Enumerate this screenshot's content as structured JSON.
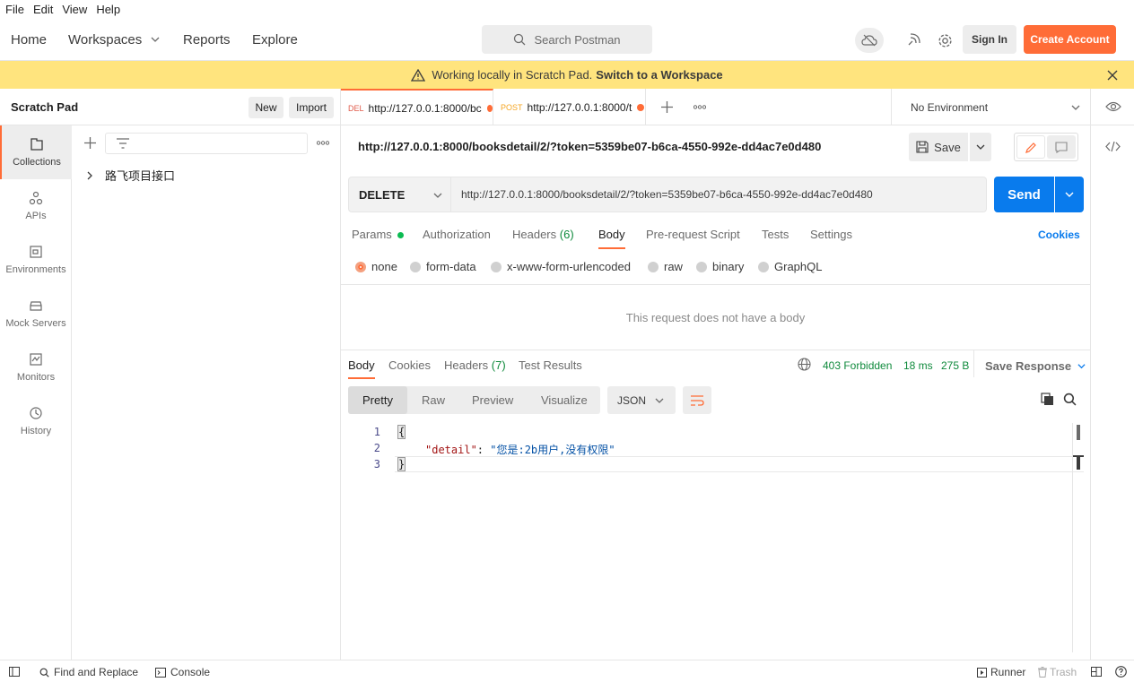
{
  "menu": [
    "File",
    "Edit",
    "View",
    "Help"
  ],
  "nav": {
    "home": "Home",
    "workspaces": "Workspaces",
    "reports": "Reports",
    "explore": "Explore"
  },
  "search": {
    "placeholder": "Search Postman"
  },
  "header": {
    "signin": "Sign In",
    "create_account": "Create Account"
  },
  "banner": {
    "text": "Working locally in Scratch Pad.",
    "link": "Switch to a Workspace"
  },
  "sidebar": {
    "title": "Scratch Pad",
    "new_label": "New",
    "import_label": "Import",
    "items": [
      {
        "label": "Collections"
      },
      {
        "label": "APIs"
      },
      {
        "label": "Environments"
      },
      {
        "label": "Mock Servers"
      },
      {
        "label": "Monitors"
      },
      {
        "label": "History"
      }
    ],
    "collection_name": "路飞项目接口"
  },
  "tabs": [
    {
      "method": "DEL",
      "url": "http://127.0.0.1:8000/bc"
    },
    {
      "method": "POST",
      "url": "http://127.0.0.1:8000/t"
    }
  ],
  "environment": "No Environment",
  "request": {
    "title": "http://127.0.0.1:8000/booksdetail/2/?token=5359be07-b6ca-4550-992e-dd4ac7e0d480",
    "save_label": "Save",
    "method": "DELETE",
    "url": "http://127.0.0.1:8000/booksdetail/2/?token=5359be07-b6ca-4550-992e-dd4ac7e0d480",
    "send_label": "Send",
    "tabs": {
      "params": "Params",
      "authorization": "Authorization",
      "headers": "Headers",
      "headers_count": "(6)",
      "body": "Body",
      "prerequest": "Pre-request Script",
      "tests": "Tests",
      "settings": "Settings",
      "cookies": "Cookies"
    },
    "body_types": [
      "none",
      "form-data",
      "x-www-form-urlencoded",
      "raw",
      "binary",
      "GraphQL"
    ],
    "no_body": "This request does not have a body"
  },
  "response": {
    "tabs": {
      "body": "Body",
      "cookies": "Cookies",
      "headers": "Headers",
      "headers_count": "(7)",
      "tests": "Test Results"
    },
    "status": "403 Forbidden",
    "time": "18 ms",
    "size": "275 B",
    "save_label": "Save Response",
    "views": [
      "Pretty",
      "Raw",
      "Preview",
      "Visualize"
    ],
    "format": "JSON",
    "code": {
      "l1": "{",
      "key": "\"detail\"",
      "sep": ": ",
      "value": "\"您是:2b用户,没有权限\"",
      "l3": "}"
    }
  },
  "statusbar": {
    "find": "Find and Replace",
    "console": "Console",
    "runner": "Runner",
    "trash": "Trash"
  },
  "colors": {
    "accent": "#ff6c37",
    "send": "#097bed",
    "banner": "#ffe47e",
    "status_ok": "#0f8a3c"
  }
}
